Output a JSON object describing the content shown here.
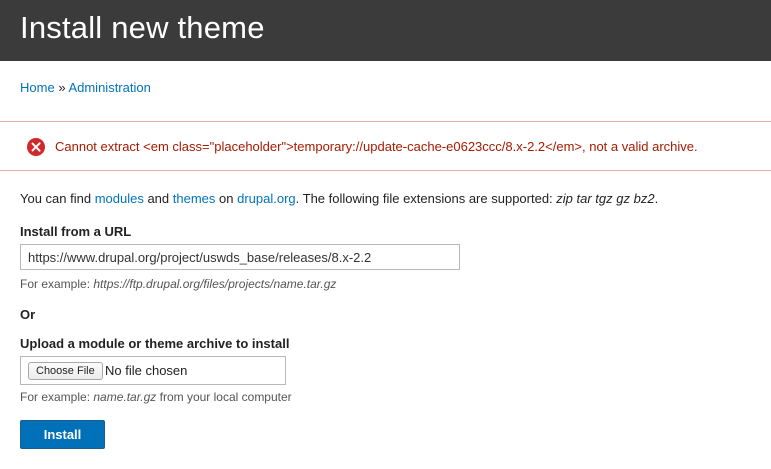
{
  "header": {
    "title": "Install new theme"
  },
  "breadcrumb": {
    "home": "Home",
    "separator": "»",
    "administration": "Administration"
  },
  "error": {
    "icon": "error-circle-x-icon",
    "message": "Cannot extract <em class=\"placeholder\">temporary://update-cache-e0623ccc/8.x-2.2</em>, not a valid archive."
  },
  "help": {
    "text_before": "You can find ",
    "modules_link": "modules",
    "and": " and ",
    "themes_link": "themes",
    "on": " on ",
    "drupal_link": "drupal.org",
    "text_after": ". The following file extensions are supported: ",
    "extensions": "zip tar tgz gz bz2",
    "period": "."
  },
  "url_section": {
    "label": "Install from a URL",
    "value": "https://www.drupal.org/project/uswds_base/releases/8.x-2.2",
    "example_prefix": "For example: ",
    "example": "https://ftp.drupal.org/files/projects/name.tar.gz"
  },
  "or_label": "Or",
  "upload_section": {
    "label": "Upload a module or theme archive to install",
    "choose_button": "Choose File",
    "file_status": "No file chosen",
    "example_prefix": "For example: ",
    "example": "name.tar.gz",
    "example_suffix": " from your local computer"
  },
  "submit": {
    "label": "Install"
  },
  "colors": {
    "header_bg": "#3b3b3b",
    "link": "#0074bd",
    "error_text": "#a51b00",
    "error_icon": "#d0292b",
    "button_bg": "#0071b8"
  }
}
